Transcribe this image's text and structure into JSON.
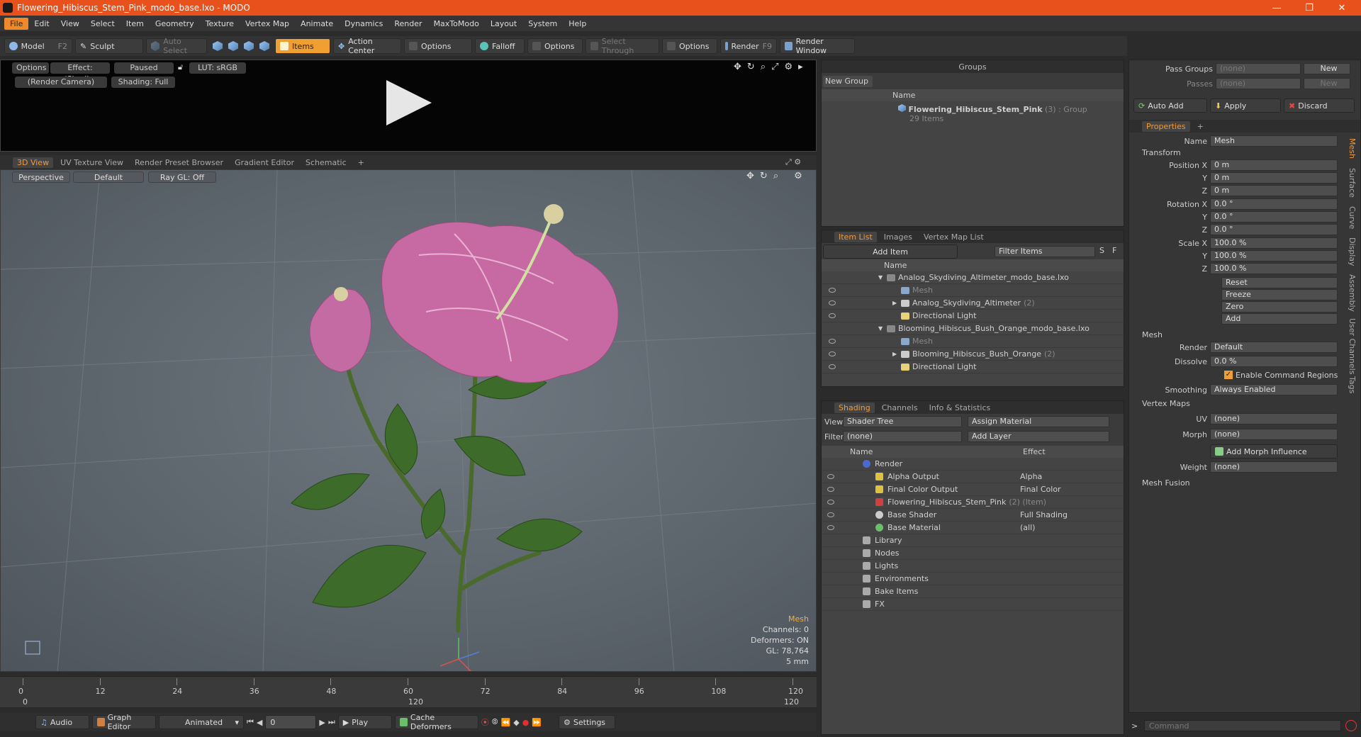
{
  "app": {
    "title": "Flowering_Hibiscus_Stem_Pink_modo_base.lxo - MODO",
    "window_controls": [
      "—",
      "❐",
      "✕"
    ]
  },
  "menu": [
    "File",
    "Edit",
    "View",
    "Select",
    "Item",
    "Geometry",
    "Texture",
    "Vertex Map",
    "Animate",
    "Dynamics",
    "Render",
    "MaxToModo",
    "Layout",
    "System",
    "Help"
  ],
  "toolbar": {
    "model": "Model",
    "model_key": "F2",
    "sculpt": "Sculpt",
    "auto_select": "Auto Select",
    "items": "Items",
    "action_center": "Action Center",
    "options1": "Options",
    "falloff": "Falloff",
    "options2": "Options",
    "select_through": "Select Through",
    "options3": "Options",
    "render": "Render",
    "render_key": "F9",
    "render_window": "Render Window"
  },
  "render_view": {
    "options": "Options",
    "effect": "Effect: (Shadi...",
    "paused": "Paused",
    "lut": "LUT: sRGB",
    "camera": "(Render Camera)",
    "shading": "Shading: Full"
  },
  "viewport_tabs": [
    "3D View",
    "UV Texture View",
    "Render Preset Browser",
    "Gradient Editor",
    "Schematic"
  ],
  "viewport": {
    "perspective": "Perspective",
    "default": "Default",
    "raygl": "Ray GL: Off",
    "info": {
      "mesh": "Mesh",
      "channels": "Channels: 0",
      "deformers": "Deformers: ON",
      "gl": "GL: 78,764",
      "scale": "5 mm"
    }
  },
  "timeline": {
    "ticks": [
      "0",
      "12",
      "24",
      "36",
      "48",
      "60",
      "72",
      "84",
      "96",
      "108",
      "120"
    ],
    "bottom_ticks": [
      "0",
      "120",
      "120"
    ]
  },
  "bottom": {
    "audio": "Audio",
    "graph_editor": "Graph Editor",
    "animated": "Animated",
    "frame": "0",
    "play": "Play",
    "cache_deformers": "Cache Deformers",
    "settings": "Settings"
  },
  "groups": {
    "title": "Groups",
    "new_group": "New Group",
    "col_name": "Name",
    "item_name": "Flowering_Hibiscus_Stem_Pink",
    "item_suffix": "(3) : Group",
    "item_count": "29 Items"
  },
  "item_list": {
    "tabs": [
      "Item List",
      "Images",
      "Vertex Map List"
    ],
    "add_item": "Add Item",
    "filter": "Filter Items",
    "s": "S",
    "f": "F",
    "col_name": "Name",
    "rows": [
      {
        "label": "Analog_Skydiving_Altimeter_modo_base.lxo",
        "indent": 0,
        "type": "scene"
      },
      {
        "label": "Mesh",
        "indent": 1,
        "type": "mesh"
      },
      {
        "label": "Analog_Skydiving_Altimeter",
        "suffix": "(2)",
        "indent": 1,
        "type": "group"
      },
      {
        "label": "Directional Light",
        "indent": 1,
        "type": "light"
      },
      {
        "label": "Blooming_Hibiscus_Bush_Orange_modo_base.lxo",
        "indent": 0,
        "type": "scene"
      },
      {
        "label": "Mesh",
        "indent": 1,
        "type": "mesh"
      },
      {
        "label": "Blooming_Hibiscus_Bush_Orange",
        "suffix": "(2)",
        "indent": 1,
        "type": "group"
      },
      {
        "label": "Directional Light",
        "indent": 1,
        "type": "light"
      }
    ]
  },
  "shading": {
    "tabs": [
      "Shading",
      "Channels",
      "Info & Statistics"
    ],
    "view_label": "View",
    "view_value": "Shader Tree",
    "assign": "Assign Material",
    "filter_label": "Filter",
    "filter_value": "(none)",
    "add_layer": "Add Layer",
    "col_name": "Name",
    "col_effect": "Effect",
    "rows": [
      {
        "name": "Render",
        "effect": "",
        "indent": 0
      },
      {
        "name": "Alpha Output",
        "effect": "Alpha",
        "indent": 1
      },
      {
        "name": "Final Color Output",
        "effect": "Final Color",
        "indent": 1
      },
      {
        "name": "Flowering_Hibiscus_Stem_Pink",
        "suffix": "(2) (Item)",
        "effect": "",
        "indent": 1
      },
      {
        "name": "Base Shader",
        "effect": "Full Shading",
        "indent": 1
      },
      {
        "name": "Base Material",
        "effect": "(all)",
        "indent": 1
      },
      {
        "name": "Library",
        "effect": "",
        "indent": 0
      },
      {
        "name": "Nodes",
        "effect": "",
        "indent": 0
      },
      {
        "name": "Lights",
        "effect": "",
        "indent": 0
      },
      {
        "name": "Environments",
        "effect": "",
        "indent": 0
      },
      {
        "name": "Bake Items",
        "effect": "",
        "indent": 0
      },
      {
        "name": "FX",
        "effect": "",
        "indent": 0
      }
    ]
  },
  "right": {
    "pass_groups": "Pass Groups",
    "passes": "Passes",
    "none": "(none)",
    "new": "New",
    "auto_add": "Auto Add",
    "apply": "Apply",
    "discard": "Discard",
    "properties_tab": "Properties",
    "name_label": "Name",
    "name_value": "Mesh",
    "transform": "Transform",
    "position_label": "Position X",
    "rotation_label": "Rotation X",
    "scale_label": "Scale X",
    "y": "Y",
    "z": "Z",
    "position": [
      "0 m",
      "0 m",
      "0 m"
    ],
    "rotation": [
      "0.0 °",
      "0.0 °",
      "0.0 °"
    ],
    "scale": [
      "100.0 %",
      "100.0 %",
      "100.0 %"
    ],
    "actions": [
      "Reset",
      "Freeze",
      "Zero",
      "Add"
    ],
    "mesh": "Mesh",
    "render_label": "Render",
    "render_value": "Default",
    "dissolve_label": "Dissolve",
    "dissolve_value": "0.0 %",
    "enable_cmd": "Enable Command Regions",
    "smoothing_label": "Smoothing",
    "smoothing_value": "Always Enabled",
    "vertex_maps": "Vertex Maps",
    "uv_label": "UV",
    "uv_value": "(none)",
    "morph_label": "Morph",
    "morph_value": "(none)",
    "add_morph": "Add Morph Influence",
    "weight_label": "Weight",
    "weight_value": "(none)",
    "mesh_fusion": "Mesh Fusion",
    "side_tabs": [
      "Mesh",
      "Surface",
      "Curve",
      "Display",
      "Assembly",
      "User Channels",
      "Tags"
    ],
    "command_placeholder": "Command"
  }
}
